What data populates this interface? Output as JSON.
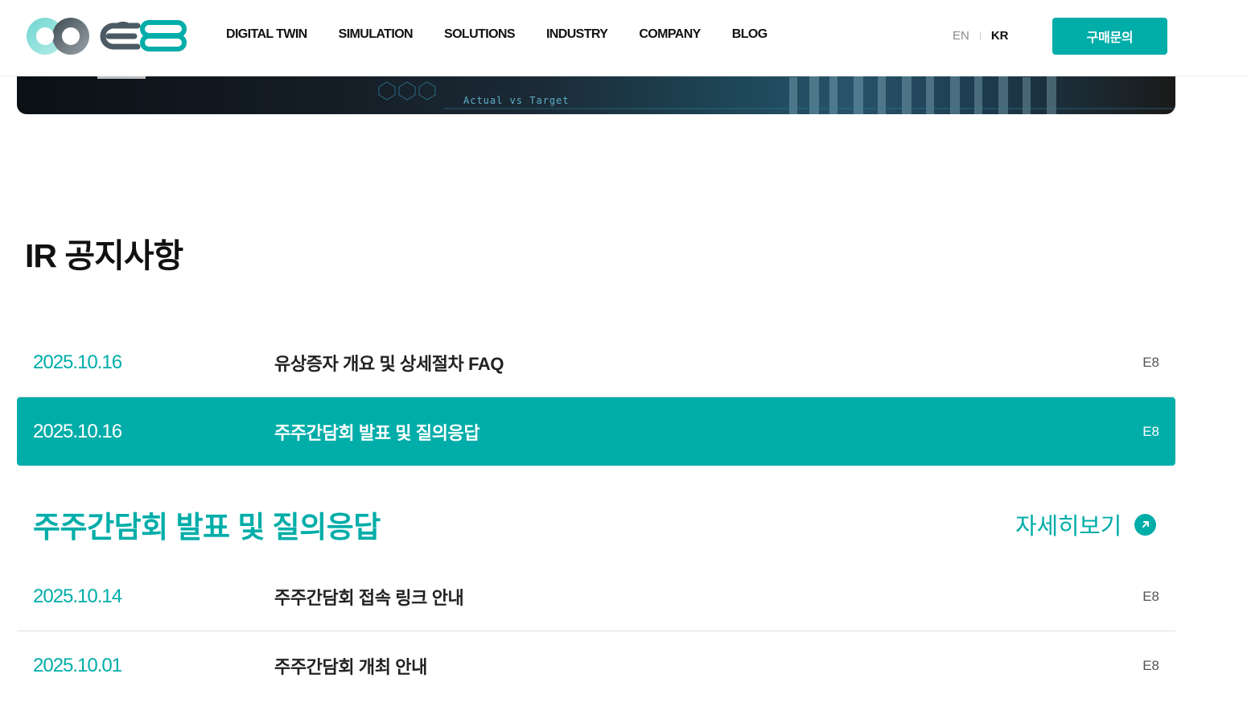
{
  "header": {
    "nav": [
      "DIGITAL TWIN",
      "SIMULATION",
      "SOLUTIONS",
      "INDUSTRY",
      "COMPANY",
      "BLOG"
    ],
    "lang_en": "EN",
    "lang_kr": "KR",
    "cta_label": "구매문의"
  },
  "hero": {
    "overlay_text": "Actual vs Target"
  },
  "section": {
    "title": "IR 공지사항"
  },
  "notices": [
    {
      "date": "2025.10.16",
      "title": "유상증자 개요 및 상세절차 FAQ",
      "author": "E8"
    },
    {
      "date": "2025.10.16",
      "title": "주주간담회 발표 및 질의응답",
      "author": "E8"
    },
    {
      "date": "2025.10.14",
      "title": "주주간담회 접속 링크 안내",
      "author": "E8"
    },
    {
      "date": "2025.10.01",
      "title": "주주간담회 개최 안내",
      "author": "E8"
    }
  ],
  "detail": {
    "title": "주주간담회 발표 및 질의응답",
    "more_label": "자세히보기"
  },
  "colors": {
    "accent": "#00ada9",
    "text": "#222222"
  }
}
